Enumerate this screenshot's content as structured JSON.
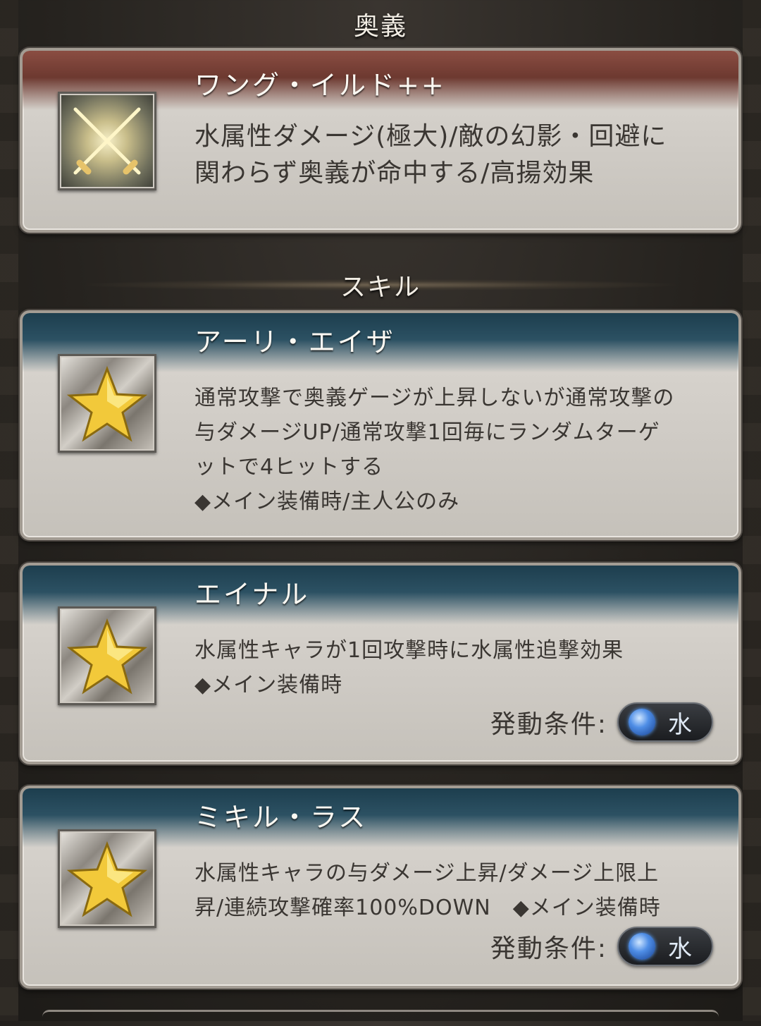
{
  "sections": {
    "ougi_header": "奥義",
    "skill_header": "スキル"
  },
  "ougi": {
    "name": "ワング・イルド++",
    "desc_line1": "水属性ダメージ(極大)/敵の幻影・回避に",
    "desc_line2": "関わらず奥義が命中する/高揚効果",
    "icon": "crossed-swords-icon"
  },
  "skills": [
    {
      "name": "アーリ・エイザ",
      "lines": [
        "通常攻撃で奥義ゲージが上昇しないが通常攻撃の",
        "与ダメージUP/通常攻撃1回毎にランダムターゲ",
        "ットで4ヒットする",
        "◆メイン装備時/主人公のみ"
      ],
      "icon": "star-icon"
    },
    {
      "name": "エイナル",
      "lines": [
        "水属性キャラが1回攻撃時に水属性追撃効果",
        "◆メイン装備時"
      ],
      "condition_label": "発動条件:",
      "condition_value": "水",
      "icon": "star-icon"
    },
    {
      "name": "ミキル・ラス",
      "lines": [
        "水属性キャラの与ダメージ上昇/ダメージ上限上",
        "昇/連続攻撃確率100%DOWN　◆メイン装備時"
      ],
      "condition_label": "発動条件:",
      "condition_value": "水",
      "icon": "star-icon"
    }
  ],
  "colors": {
    "ougi_band": "#6d3930",
    "skill_band": "#1d3e4e",
    "water_element": "#4f8ee6"
  }
}
